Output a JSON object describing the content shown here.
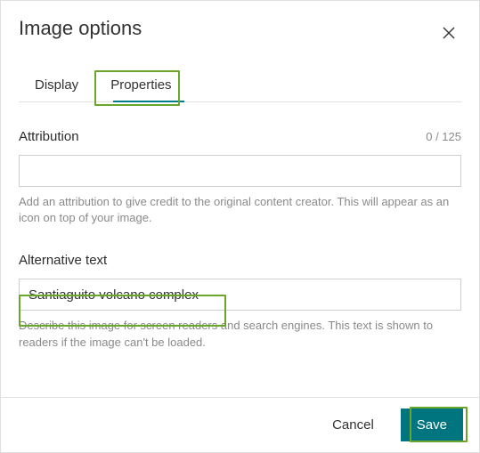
{
  "dialog": {
    "title": "Image options",
    "close_icon": "close-icon"
  },
  "tabs": {
    "items": [
      {
        "label": "Display",
        "active": false
      },
      {
        "label": "Properties",
        "active": true
      }
    ]
  },
  "fields": {
    "attribution": {
      "label": "Attribution",
      "counter": "0 / 125",
      "value": "",
      "placeholder": "",
      "help": "Add an attribution to give credit to the original content creator. This will appear as an icon on top of your image."
    },
    "alt_text": {
      "label": "Alternative text",
      "value": "Santiaguito volcano complex",
      "placeholder": "",
      "help": "Describe this image for screen readers and search engines. This text is shown to readers if the image can't be loaded."
    }
  },
  "footer": {
    "cancel_label": "Cancel",
    "save_label": "Save"
  }
}
